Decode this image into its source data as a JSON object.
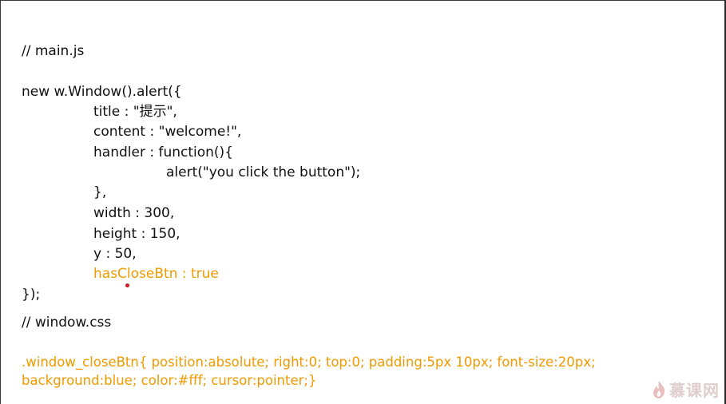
{
  "code": {
    "main_comment": "// main.js",
    "alert_call": "new w.Window().alert({",
    "title_line": "title : \"提示\",",
    "content_line": "content : \"welcome!\",",
    "handler_line": "handler : function(){",
    "alert_line": "alert(\"you click the button\");",
    "close_brace_comma": "},",
    "width_line": "width : 300,",
    "height_line": "height : 150,",
    "y_line": "y : 50,",
    "hasclose_line": "hasCloseBtn : true",
    "end_line": "});",
    "css_comment": "// window.css",
    "css_line1": ".window_closeBtn{ position:absolute; right:0; top:0; padding:5px 10px; font-size:20px;",
    "css_line2": "background:blue; color:#fff; cursor:pointer;}"
  },
  "watermark": {
    "text": "慕课网",
    "icon": "flame-icon"
  },
  "colors": {
    "highlight": "#f09a00",
    "text": "#111111"
  }
}
